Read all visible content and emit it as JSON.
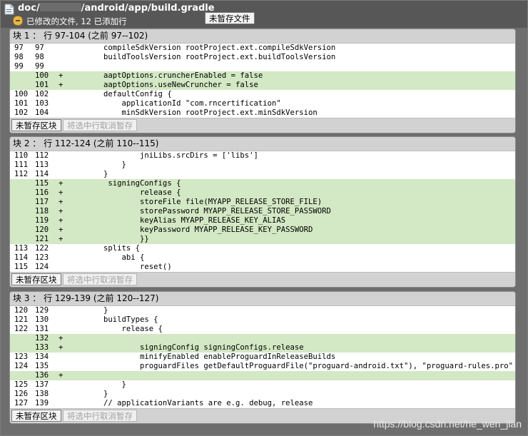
{
  "header": {
    "path_prefix": "doc/",
    "path_suffix": "/android/app/build.gradle",
    "status": "已修改的文件, 12 已添加行",
    "unstage_file_label": "未暂存文件"
  },
  "hunks": [
    {
      "title": "块 1 ： 行 97-104 (之前 97--102)",
      "unstage_label": "未暂存区块",
      "unstage_selected_label": "将选中行取消暂存",
      "lines": [
        {
          "old": "97",
          "new": "97",
          "sign": "",
          "code": "        compileSdkVersion rootProject.ext.compileSdkVersion",
          "type": "ctx"
        },
        {
          "old": "98",
          "new": "98",
          "sign": "",
          "code": "        buildToolsVersion rootProject.ext.buildToolsVersion",
          "type": "ctx"
        },
        {
          "old": "99",
          "new": "99",
          "sign": "",
          "code": "",
          "type": "ctx"
        },
        {
          "old": "",
          "new": "100",
          "sign": "+",
          "code": "        aaptOptions.cruncherEnabled = false",
          "type": "add"
        },
        {
          "old": "",
          "new": "101",
          "sign": "+",
          "code": "        aaptOptions.useNewCruncher = false",
          "type": "add"
        },
        {
          "old": "100",
          "new": "102",
          "sign": "",
          "code": "        defaultConfig {",
          "type": "ctx"
        },
        {
          "old": "101",
          "new": "103",
          "sign": "",
          "code": "            applicationId \"com.rncertification\"",
          "type": "ctx"
        },
        {
          "old": "102",
          "new": "104",
          "sign": "",
          "code": "            minSdkVersion rootProject.ext.minSdkVersion",
          "type": "ctx"
        }
      ]
    },
    {
      "title": "块 2 ： 行 112-124 (之前 110--115)",
      "unstage_label": "未暂存区块",
      "unstage_selected_label": "将选中行取消暂存",
      "lines": [
        {
          "old": "110",
          "new": "112",
          "sign": "",
          "code": "                jniLibs.srcDirs = ['libs']",
          "type": "ctx"
        },
        {
          "old": "111",
          "new": "113",
          "sign": "",
          "code": "            }",
          "type": "ctx"
        },
        {
          "old": "112",
          "new": "114",
          "sign": "",
          "code": "        }",
          "type": "ctx"
        },
        {
          "old": "",
          "new": "115",
          "sign": "+",
          "code": "         signingConfigs {",
          "type": "add"
        },
        {
          "old": "",
          "new": "116",
          "sign": "+",
          "code": "                release {",
          "type": "add"
        },
        {
          "old": "",
          "new": "117",
          "sign": "+",
          "code": "                storeFile file(MYAPP_RELEASE_STORE_FILE)",
          "type": "add"
        },
        {
          "old": "",
          "new": "118",
          "sign": "+",
          "code": "                storePassword MYAPP_RELEASE_STORE_PASSWORD",
          "type": "add"
        },
        {
          "old": "",
          "new": "119",
          "sign": "+",
          "code": "                keyAlias MYAPP_RELEASE_KEY_ALIAS",
          "type": "add"
        },
        {
          "old": "",
          "new": "120",
          "sign": "+",
          "code": "                keyPassword MYAPP_RELEASE_KEY_PASSWORD",
          "type": "add"
        },
        {
          "old": "",
          "new": "121",
          "sign": "+",
          "code": "                }}",
          "type": "add"
        },
        {
          "old": "113",
          "new": "122",
          "sign": "",
          "code": "        splits {",
          "type": "ctx"
        },
        {
          "old": "114",
          "new": "123",
          "sign": "",
          "code": "            abi {",
          "type": "ctx"
        },
        {
          "old": "115",
          "new": "124",
          "sign": "",
          "code": "                reset()",
          "type": "ctx"
        }
      ]
    },
    {
      "title": "块 3 ： 行 129-139 (之前 120--127)",
      "unstage_label": "未暂存区块",
      "unstage_selected_label": "将选中行取消暂存",
      "lines": [
        {
          "old": "120",
          "new": "129",
          "sign": "",
          "code": "        }",
          "type": "ctx"
        },
        {
          "old": "121",
          "new": "130",
          "sign": "",
          "code": "        buildTypes {",
          "type": "ctx"
        },
        {
          "old": "122",
          "new": "131",
          "sign": "",
          "code": "            release {",
          "type": "ctx"
        },
        {
          "old": "",
          "new": "132",
          "sign": "+",
          "code": "",
          "type": "add"
        },
        {
          "old": "",
          "new": "133",
          "sign": "+",
          "code": "                signingConfig signingConfigs.release",
          "type": "add"
        },
        {
          "old": "123",
          "new": "134",
          "sign": "",
          "code": "                minifyEnabled enableProguardInReleaseBuilds",
          "type": "ctx"
        },
        {
          "old": "124",
          "new": "135",
          "sign": "",
          "code": "                proguardFiles getDefaultProguardFile(\"proguard-android.txt\"), \"proguard-rules.pro\"",
          "type": "ctx"
        },
        {
          "old": "",
          "new": "136",
          "sign": "+",
          "code": "",
          "type": "add"
        },
        {
          "old": "125",
          "new": "137",
          "sign": "",
          "code": "            }",
          "type": "ctx"
        },
        {
          "old": "126",
          "new": "138",
          "sign": "",
          "code": "        }",
          "type": "ctx"
        },
        {
          "old": "127",
          "new": "139",
          "sign": "",
          "code": "        // applicationVariants are e.g. debug, release",
          "type": "ctx"
        }
      ]
    }
  ],
  "watermark": "https://blog.csdn.net/he_wen_jian",
  "colors": {
    "added_line": "#d3e8c4",
    "hunk_header": "#d2d2d2",
    "toolbar": "#575757"
  },
  "icons": {
    "file": "file-icon",
    "status": "modified-status-icon"
  }
}
